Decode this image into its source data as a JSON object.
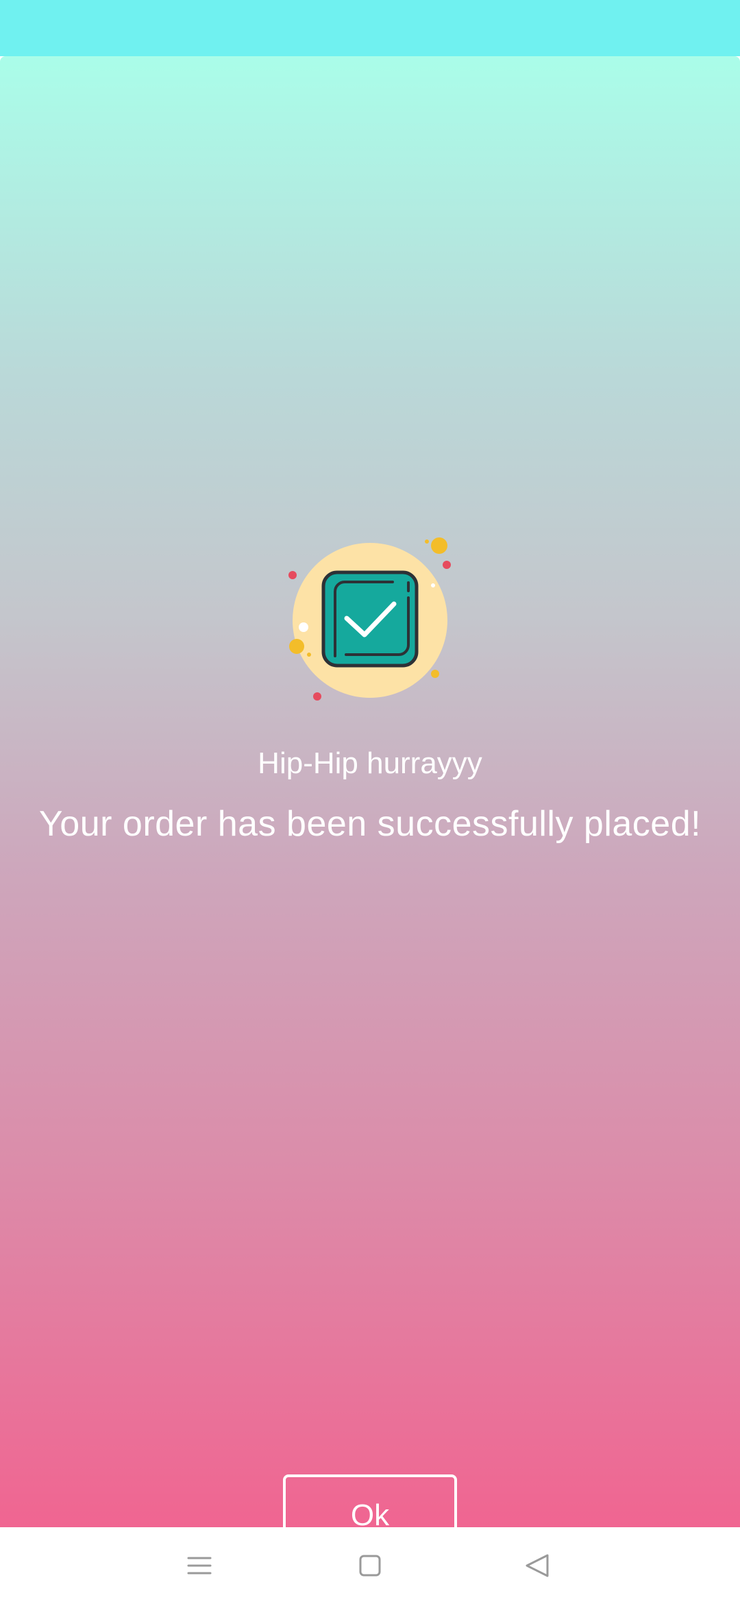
{
  "colors": {
    "status_bar": "#70f1f0",
    "gradient_top": "#aafde9",
    "gradient_bottom": "#f06591",
    "text": "#ffffff",
    "icon_circle": "#fde2a6",
    "icon_box": "#15a99d"
  },
  "success": {
    "icon": "checkbox-check-icon",
    "title": "Hip-Hip hurrayyy",
    "message": "Your order has been successfully placed!"
  },
  "actions": {
    "ok_label": "Ok"
  },
  "nav": {
    "items": [
      {
        "icon": "menu-icon"
      },
      {
        "icon": "home-square-icon"
      },
      {
        "icon": "back-triangle-icon"
      }
    ]
  }
}
